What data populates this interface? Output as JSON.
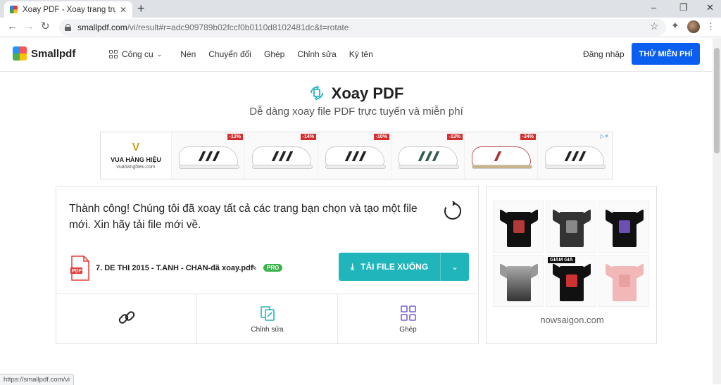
{
  "browser": {
    "tab_title": "Xoay PDF - Xoay trang trực tuyến",
    "tab_close": "✕",
    "new_tab": "+",
    "url_host": "smallpdf.com",
    "url_path": "/vi/result#r=adc909789b02fccf0b0110d8102481dc&t=rotate",
    "status_url": "https://smallpdf.com/vi"
  },
  "header": {
    "logo": "Smallpdf",
    "nav": {
      "tools": "Công cụ",
      "compress": "Nén",
      "convert": "Chuyển đổi",
      "merge": "Ghép",
      "edit": "Chỉnh sửa",
      "sign": "Ký tên"
    },
    "login": "Đăng nhập",
    "trial": "THỬ MIỄN PHÍ"
  },
  "hero": {
    "title": "Xoay PDF",
    "subtitle": "Dễ dàng xoay file PDF trực tuyến và miễn phí"
  },
  "ad_banner": {
    "brand": "VUA HÀNG HIỆU",
    "site": "vuahanghieu.com",
    "discounts": [
      "-13%",
      "-14%",
      "-10%",
      "-13%",
      "-34%"
    ]
  },
  "result": {
    "message": "Thành công! Chúng tôi đã xoay tất cả các trang bạn chọn và tạo một file mới. Xin hãy tải file mới về.",
    "file_name": "7. DE THI 2015 - T.ANH - CHAN-đã xoay.pdf",
    "pro_badge": "PRO",
    "download": "TẢI FILE XUỐNG",
    "actions": {
      "share_label": "",
      "edit_label": "Chỉnh sửa",
      "merge_label": "Ghép"
    }
  },
  "side_ad": {
    "sale_tag": "GIẢM GIÁ",
    "domain": "nowsaigon.com"
  },
  "colors": {
    "primary": "#0b5ff0",
    "teal": "#1fb5bb",
    "pro": "#3bb34a",
    "discount": "#d32f2f"
  }
}
